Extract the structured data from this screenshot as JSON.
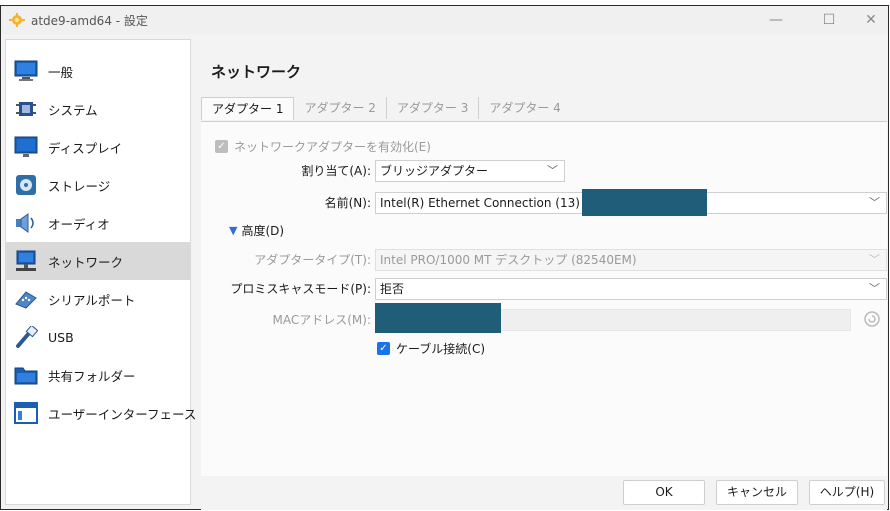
{
  "window": {
    "title": "atde9-amd64 - 設定",
    "minimize": "—",
    "maximize": "☐",
    "close": "✕"
  },
  "sidebar": {
    "items": [
      {
        "label": "一般",
        "icon": "monitor-icon"
      },
      {
        "label": "システム",
        "icon": "chip-icon"
      },
      {
        "label": "ディスプレイ",
        "icon": "display-icon"
      },
      {
        "label": "ストレージ",
        "icon": "disk-icon"
      },
      {
        "label": "オーディオ",
        "icon": "speaker-icon"
      },
      {
        "label": "ネットワーク",
        "icon": "network-icon",
        "active": true
      },
      {
        "label": "シリアルポート",
        "icon": "serial-port-icon"
      },
      {
        "label": "USB",
        "icon": "usb-icon"
      },
      {
        "label": "共有フォルダー",
        "icon": "folder-icon"
      },
      {
        "label": "ユーザーインターフェース",
        "icon": "ui-icon"
      }
    ]
  },
  "main": {
    "title": "ネットワーク",
    "tabs": [
      {
        "label": "アダプター 1",
        "active": true
      },
      {
        "label": "アダプター 2"
      },
      {
        "label": "アダプター 3"
      },
      {
        "label": "アダプター 4"
      }
    ],
    "enable_adapter": {
      "label": "ネットワークアダプターを有効化(E)",
      "checked": true,
      "enabled": false
    },
    "attached_to": {
      "label": "割り当て(A):",
      "value": "ブリッジアダプター"
    },
    "name": {
      "label": "名前(N):",
      "value": "Intel(R) Ethernet Connection (13)"
    },
    "advanced": {
      "label": "高度(D)",
      "expanded": true
    },
    "adapter_type": {
      "label": "アダプタータイプ(T):",
      "value": "Intel PRO/1000 MT デスクトップ (82540EM)"
    },
    "promiscuous": {
      "label": "プロミスキャスモード(P):",
      "value": "拒否"
    },
    "mac": {
      "label": "MACアドレス(M):",
      "value": ""
    },
    "cable": {
      "label": "ケーブル接続(C)",
      "checked": true
    }
  },
  "footer": {
    "ok": "OK",
    "cancel": "キャンセル",
    "help": "ヘルプ(H)"
  },
  "colors": {
    "accent": "#1a73e8",
    "redaction": "#1f5d78",
    "active_item": "#d9d9d9"
  }
}
